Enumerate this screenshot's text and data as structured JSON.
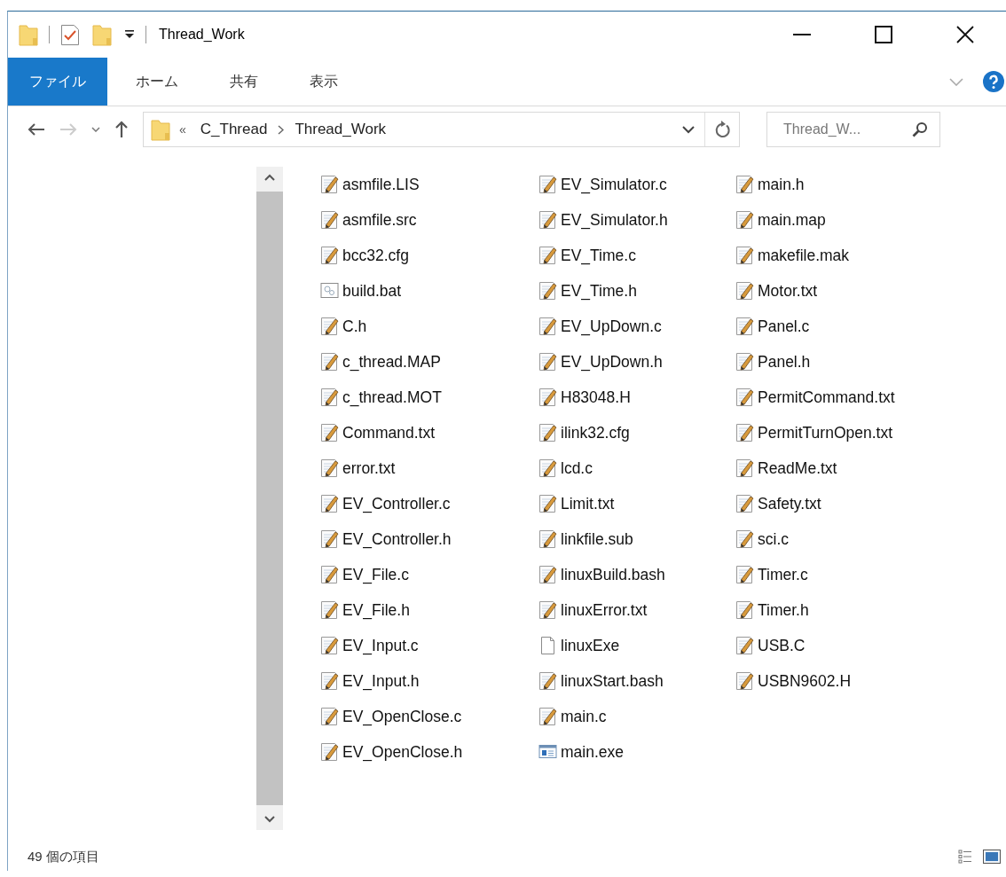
{
  "window": {
    "title": "Thread_Work"
  },
  "ribbon_tabs": [
    {
      "label": "ファイル",
      "selected": true
    },
    {
      "label": "ホーム",
      "selected": false
    },
    {
      "label": "共有",
      "selected": false
    },
    {
      "label": "表示",
      "selected": false
    }
  ],
  "address_bar": {
    "overflow": "«",
    "path": [
      "C_Thread",
      "Thread_Work"
    ]
  },
  "search": {
    "placeholder": "Thread_W..."
  },
  "files": [
    {
      "name": "asmfile.LIS",
      "kind": "text"
    },
    {
      "name": "asmfile.src",
      "kind": "text"
    },
    {
      "name": "bcc32.cfg",
      "kind": "text"
    },
    {
      "name": "build.bat",
      "kind": "script"
    },
    {
      "name": "C.h",
      "kind": "text"
    },
    {
      "name": "c_thread.MAP",
      "kind": "text"
    },
    {
      "name": "c_thread.MOT",
      "kind": "text"
    },
    {
      "name": "Command.txt",
      "kind": "text"
    },
    {
      "name": "error.txt",
      "kind": "text"
    },
    {
      "name": "EV_Controller.c",
      "kind": "text"
    },
    {
      "name": "EV_Controller.h",
      "kind": "text"
    },
    {
      "name": "EV_File.c",
      "kind": "text"
    },
    {
      "name": "EV_File.h",
      "kind": "text"
    },
    {
      "name": "EV_Input.c",
      "kind": "text"
    },
    {
      "name": "EV_Input.h",
      "kind": "text"
    },
    {
      "name": "EV_OpenClose.c",
      "kind": "text"
    },
    {
      "name": "EV_OpenClose.h",
      "kind": "text"
    },
    {
      "name": "EV_Simulator.c",
      "kind": "text"
    },
    {
      "name": "EV_Simulator.h",
      "kind": "text"
    },
    {
      "name": "EV_Time.c",
      "kind": "text"
    },
    {
      "name": "EV_Time.h",
      "kind": "text"
    },
    {
      "name": "EV_UpDown.c",
      "kind": "text"
    },
    {
      "name": "EV_UpDown.h",
      "kind": "text"
    },
    {
      "name": "H83048.H",
      "kind": "text"
    },
    {
      "name": "ilink32.cfg",
      "kind": "text"
    },
    {
      "name": "lcd.c",
      "kind": "text"
    },
    {
      "name": "Limit.txt",
      "kind": "text"
    },
    {
      "name": "linkfile.sub",
      "kind": "text"
    },
    {
      "name": "linuxBuild.bash",
      "kind": "text"
    },
    {
      "name": "linuxError.txt",
      "kind": "text"
    },
    {
      "name": "linuxExe",
      "kind": "blank"
    },
    {
      "name": "linuxStart.bash",
      "kind": "text"
    },
    {
      "name": "main.c",
      "kind": "text"
    },
    {
      "name": "main.exe",
      "kind": "app"
    },
    {
      "name": "main.h",
      "kind": "text"
    },
    {
      "name": "main.map",
      "kind": "text"
    },
    {
      "name": "makefile.mak",
      "kind": "text"
    },
    {
      "name": "Motor.txt",
      "kind": "text"
    },
    {
      "name": "Panel.c",
      "kind": "text"
    },
    {
      "name": "Panel.h",
      "kind": "text"
    },
    {
      "name": "PermitCommand.txt",
      "kind": "text"
    },
    {
      "name": "PermitTurnOpen.txt",
      "kind": "text"
    },
    {
      "name": "ReadMe.txt",
      "kind": "text"
    },
    {
      "name": "Safety.txt",
      "kind": "text"
    },
    {
      "name": "sci.c",
      "kind": "text"
    },
    {
      "name": "Timer.c",
      "kind": "text"
    },
    {
      "name": "Timer.h",
      "kind": "text"
    },
    {
      "name": "USB.C",
      "kind": "text"
    },
    {
      "name": "USBN9602.H",
      "kind": "text"
    }
  ],
  "status_bar": {
    "item_count": "49 個の項目"
  }
}
